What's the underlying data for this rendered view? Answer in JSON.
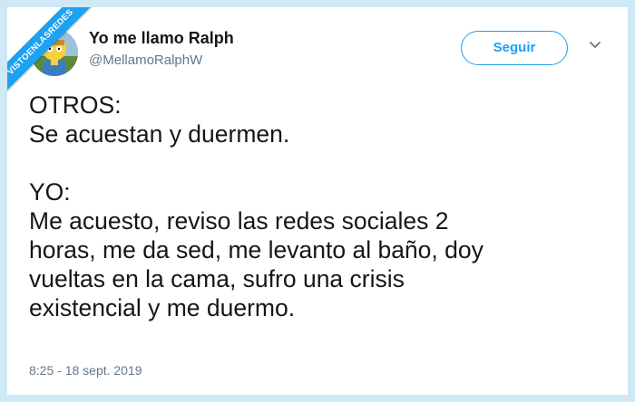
{
  "watermark": {
    "text": "VISTOENLASREDES"
  },
  "tweet": {
    "display_name": "Yo me llamo Ralph",
    "handle": "@MellamoRalphW",
    "follow_label": "Seguir",
    "menu_icon": "chevron-down-icon",
    "text": "OTROS:\nSe acuestan y duermen.\n\nYO:\nMe acuesto, reviso las redes sociales 2\nhoras, me da sed, me levanto al baño, doy\nvueltas en la cama, sufro una crisis\nexistencial y me duermo.",
    "timestamp": "8:25 - 18 sept. 2019"
  },
  "colors": {
    "accent": "#1da1f2",
    "text": "#14171a",
    "secondary": "#657786",
    "frame": "#cfe8f6"
  }
}
